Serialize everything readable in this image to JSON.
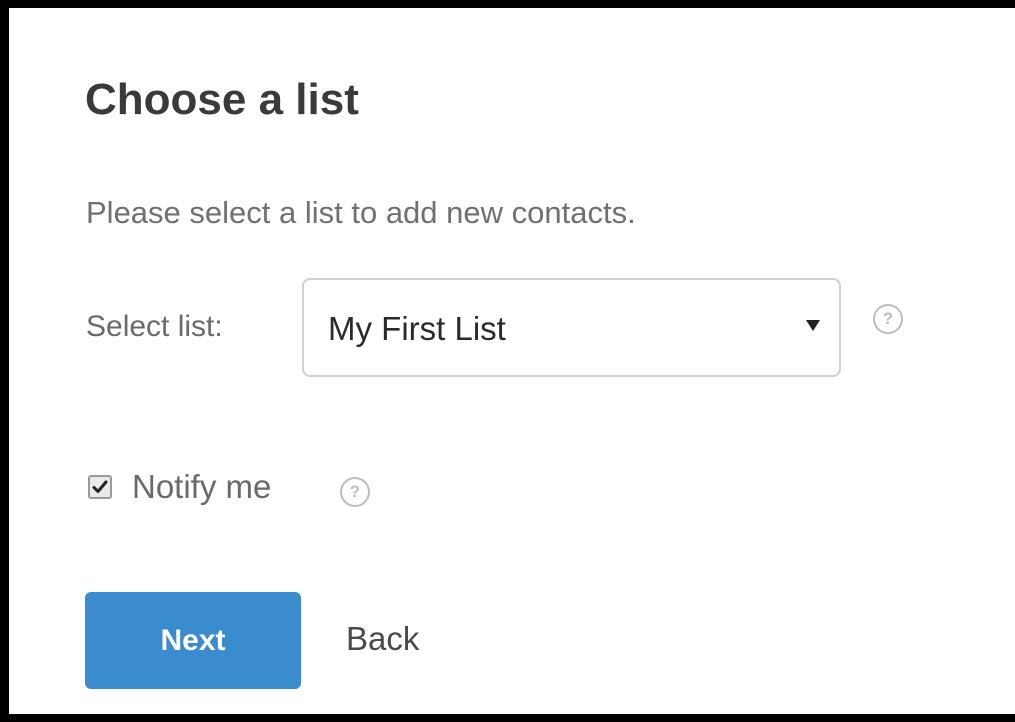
{
  "dialog": {
    "title": "Choose a list",
    "description": "Please select a list to add new contacts."
  },
  "select": {
    "label": "Select list:",
    "value": "My First List",
    "help_icon": "question-circle-icon",
    "arrow_icon": "dropdown-arrow-icon"
  },
  "notify": {
    "label": "Notify me",
    "checked": true,
    "help_icon": "question-circle-icon"
  },
  "actions": {
    "next_label": "Next",
    "back_label": "Back"
  },
  "colors": {
    "primary": "#3a8ccf",
    "title": "#3a3a3a",
    "muted_text": "#707070",
    "frame": "#000000"
  }
}
